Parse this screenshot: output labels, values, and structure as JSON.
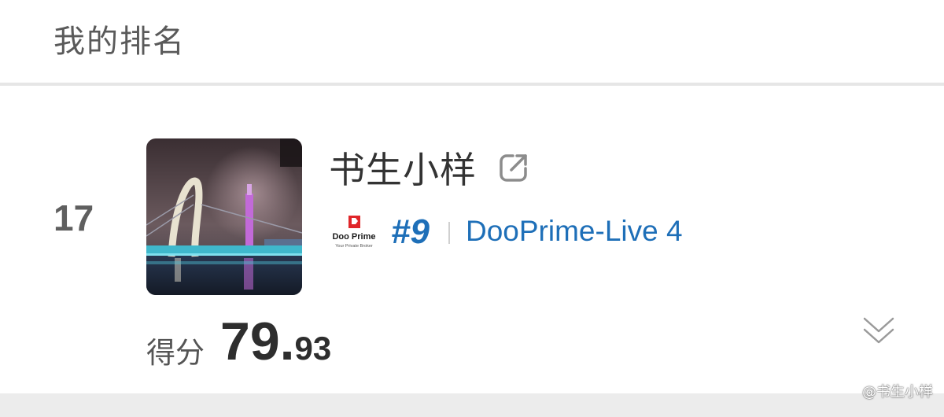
{
  "header": {
    "title": "我的排名"
  },
  "entry": {
    "rank": "17",
    "username": "书生小样",
    "broker": {
      "logo_text": "Doo Prime",
      "logo_tagline": "Your Private Broker",
      "rank": "#9",
      "account": "DooPrime-Live 4"
    },
    "score": {
      "label": "得分",
      "integer": "79.",
      "decimal": "93"
    }
  },
  "watermark": "@书生小样",
  "icons": {
    "external": "external-link-icon",
    "expand": "double-chevron-down-icon"
  }
}
